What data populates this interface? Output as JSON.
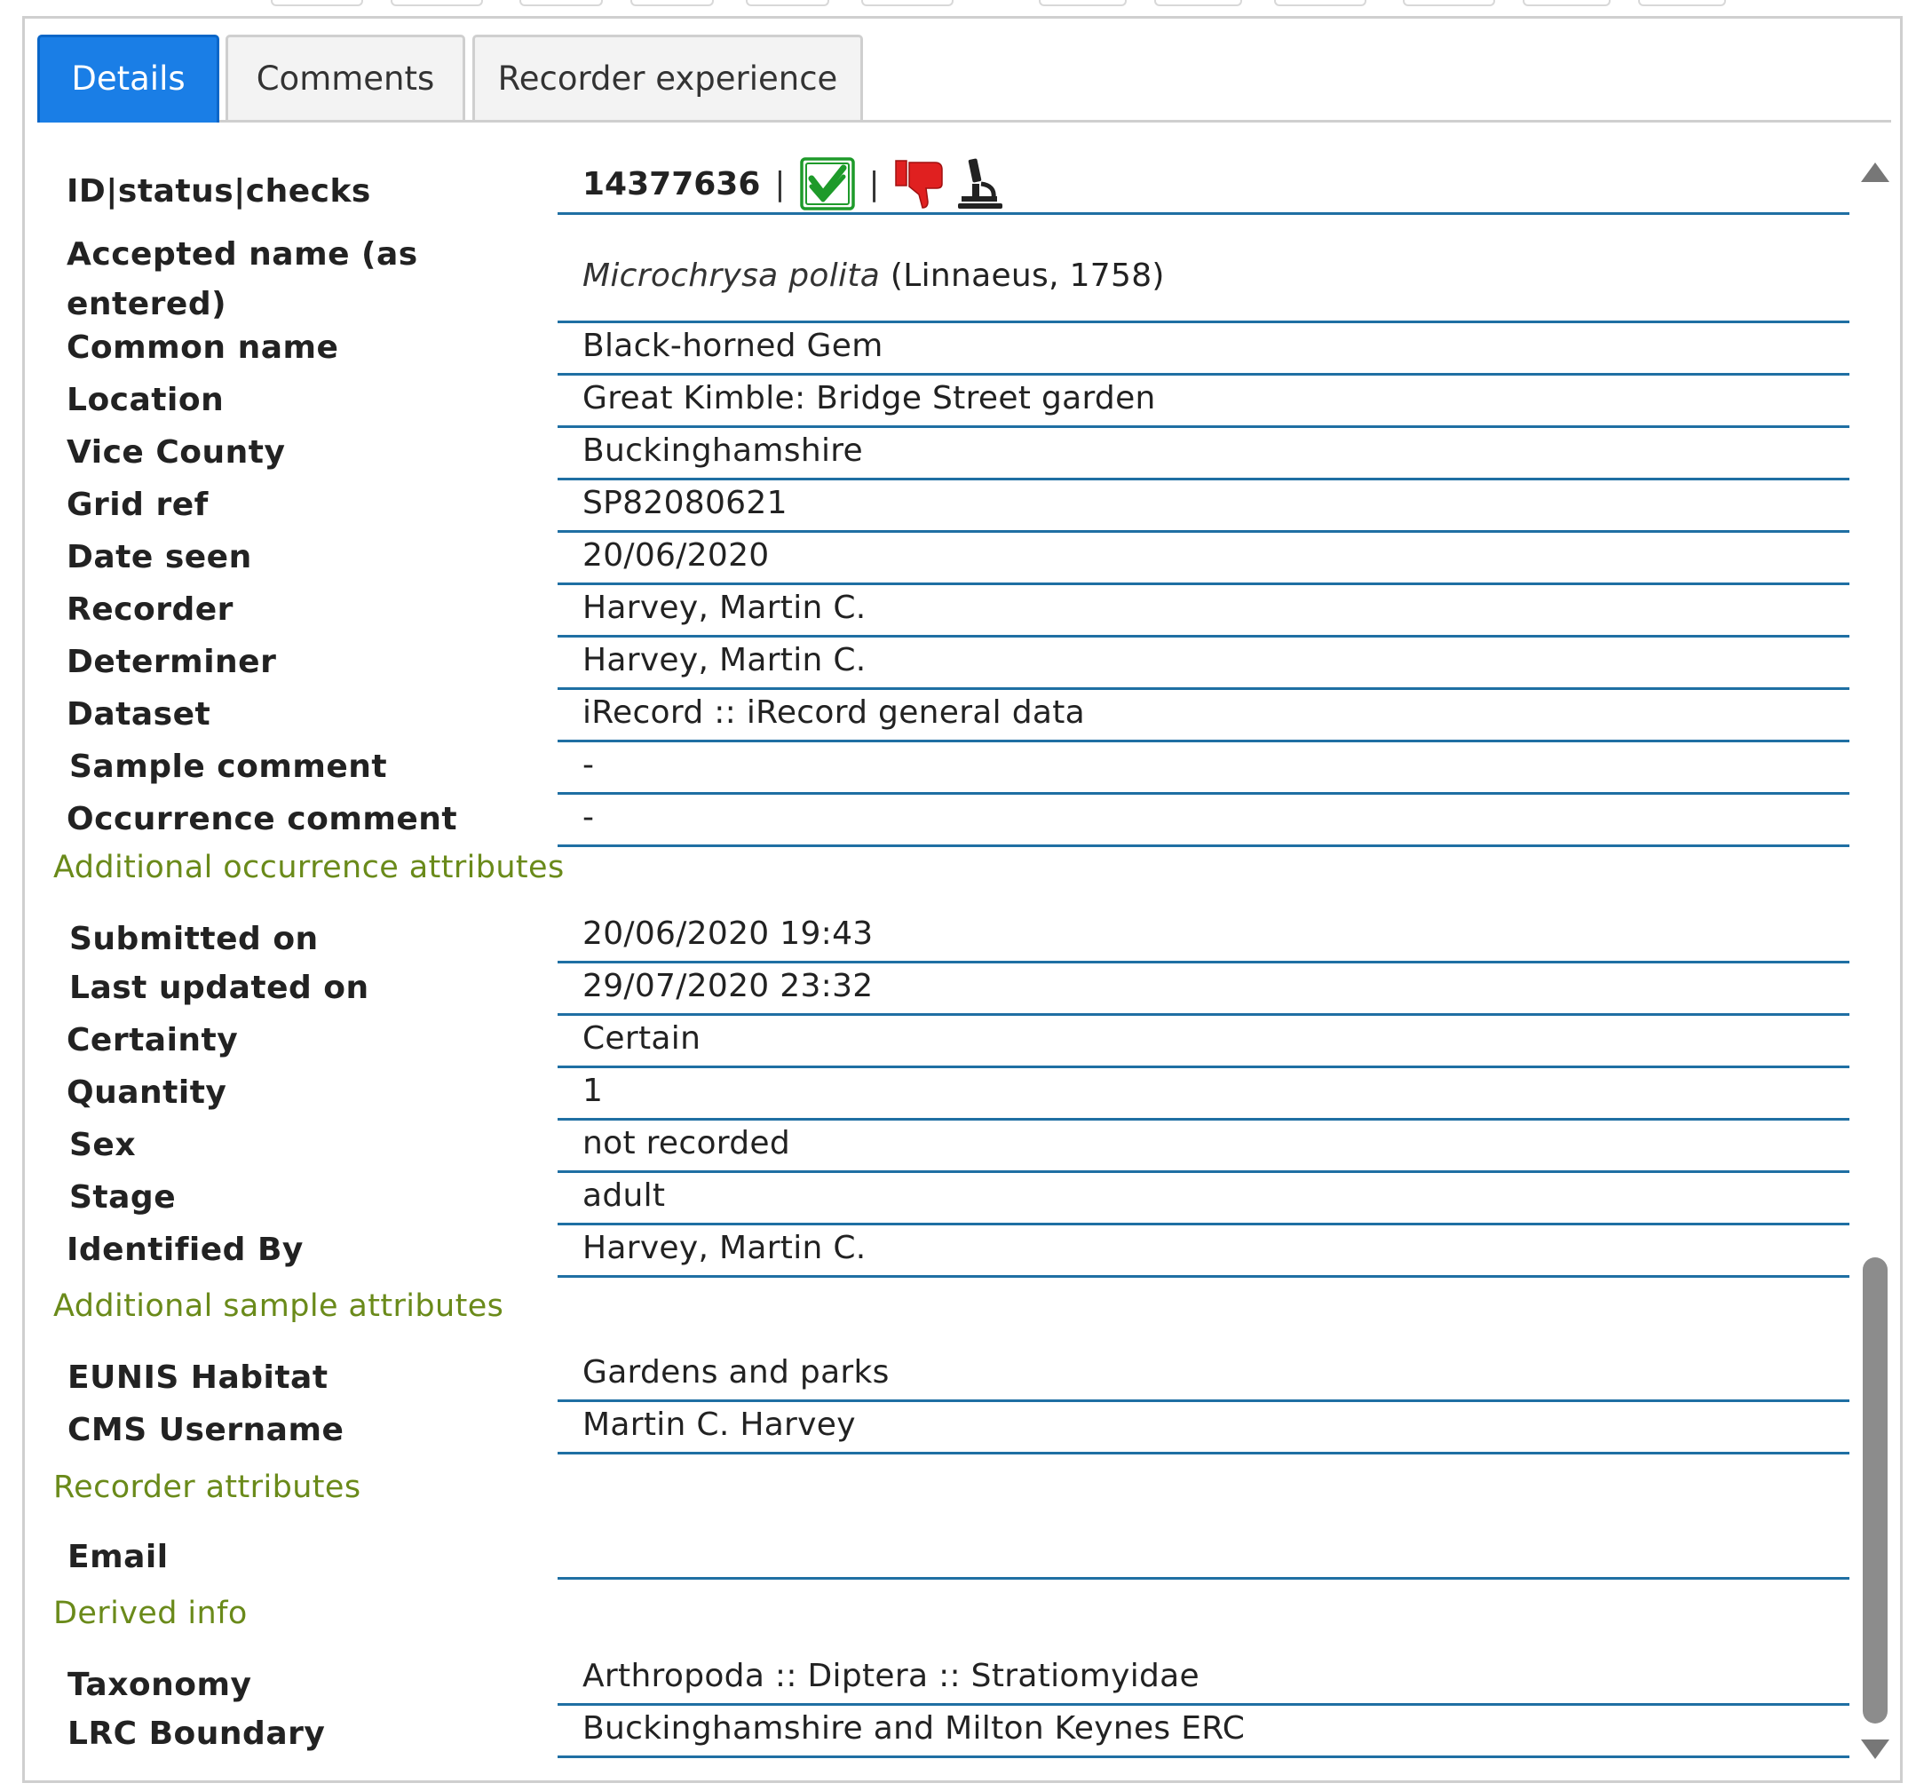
{
  "tabs": [
    {
      "label": "Details",
      "active": true
    },
    {
      "label": "Comments",
      "active": false
    },
    {
      "label": "Recorder experience",
      "active": false
    }
  ],
  "record": {
    "id_label": "ID|status|checks",
    "id_value": "14377636",
    "separator": "|",
    "status_icons": [
      "accepted-check-icon",
      "thumbs-down-icon",
      "microscope-icon"
    ],
    "accepted_name_label": "Accepted name (as entered)",
    "accepted_name_italic": "Microchrysa polita",
    "accepted_name_authority": "(Linnaeus, 1758)",
    "fields": [
      {
        "label": "Common name",
        "value": "Black-horned Gem"
      },
      {
        "label": "Location",
        "value": "Great Kimble: Bridge Street garden"
      },
      {
        "label": "Vice County",
        "value": "Buckinghamshire"
      },
      {
        "label": "Grid ref",
        "value": "SP82080621"
      },
      {
        "label": "Date seen",
        "value": "20/06/2020"
      },
      {
        "label": "Recorder",
        "value": "Harvey, Martin C."
      },
      {
        "label": "Determiner",
        "value": "Harvey, Martin C."
      },
      {
        "label": "Dataset",
        "value": "iRecord :: iRecord general data"
      },
      {
        "label": "Sample comment",
        "value": "-"
      },
      {
        "label": "Occurrence comment",
        "value": "-"
      }
    ]
  },
  "sections": {
    "occurrence": {
      "title": "Additional occurrence attributes",
      "fields": [
        {
          "label": "Submitted on",
          "value": "20/06/2020 19:43"
        },
        {
          "label": "Last updated on",
          "value": "29/07/2020 23:32"
        },
        {
          "label": "Certainty",
          "value": "Certain"
        },
        {
          "label": "Quantity",
          "value": "1"
        },
        {
          "label": "Sex",
          "value": "not recorded"
        },
        {
          "label": "Stage",
          "value": "adult"
        },
        {
          "label": "Identified By",
          "value": "Harvey, Martin C."
        }
      ]
    },
    "sample": {
      "title": "Additional sample attributes",
      "fields": [
        {
          "label": "EUNIS Habitat",
          "value": "Gardens and parks"
        },
        {
          "label": "CMS Username",
          "value": "Martin C. Harvey"
        }
      ]
    },
    "recorder": {
      "title": "Recorder attributes",
      "fields": [
        {
          "label": "Email",
          "value": ""
        }
      ]
    },
    "derived": {
      "title": "Derived info",
      "fields": [
        {
          "label": "Taxonomy",
          "value": "Arthropoda :: Diptera :: Stratiomyidae"
        },
        {
          "label": "LRC Boundary",
          "value": "Buckinghamshire and Milton Keynes ERC"
        }
      ]
    }
  },
  "colors": {
    "tab_active": "#1a7ee6",
    "section_heading": "#6a8a1a",
    "row_underline": "#1f6fa3",
    "accepted_green": "#1e9a2a",
    "thumbs_red": "#e02020"
  }
}
